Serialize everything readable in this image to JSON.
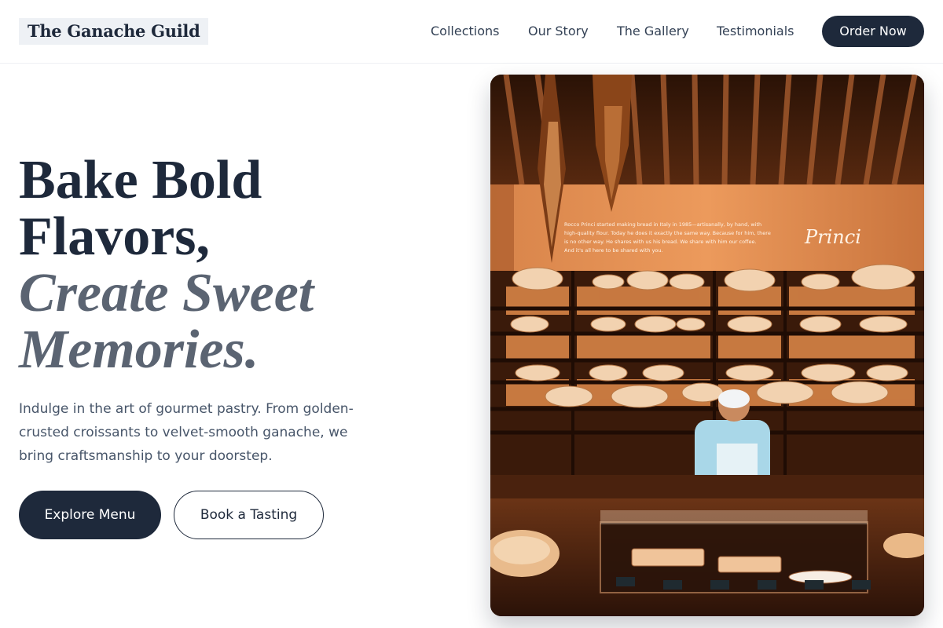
{
  "brand": {
    "name": "The Ganache Guild"
  },
  "nav": {
    "items": [
      {
        "label": "Collections"
      },
      {
        "label": "Our Story"
      },
      {
        "label": "The Gallery"
      },
      {
        "label": "Testimonials"
      }
    ],
    "cta_label": "Order Now"
  },
  "hero": {
    "headline_line1": "Bake Bold",
    "headline_line2": "Flavors,",
    "headline_italic1": "Create Sweet",
    "headline_italic2": "Memories.",
    "description": "Indulge in the art of gourmet pastry. From golden-crusted croissants to velvet-smooth ganache, we bring craftsmanship to your doorstep.",
    "primary_button": "Explore Menu",
    "secondary_button": "Book a Tasting"
  },
  "image": {
    "wall_text_1": "Rocco Princi started making bread in Italy in 1985—artisanally, by hand, with",
    "wall_text_2": "high-quality flour. Today he does it exactly the same way. Because for him, there",
    "wall_text_3": "is no other way. He shares with us his bread. We share with him our coffee.",
    "wall_text_4": "And it's all here to be shared with you.",
    "signature": "Princi"
  },
  "colors": {
    "primary": "#1e293b",
    "muted_heading": "#5b6472",
    "body_text": "#475569",
    "logo_bg": "#eef1f5"
  }
}
